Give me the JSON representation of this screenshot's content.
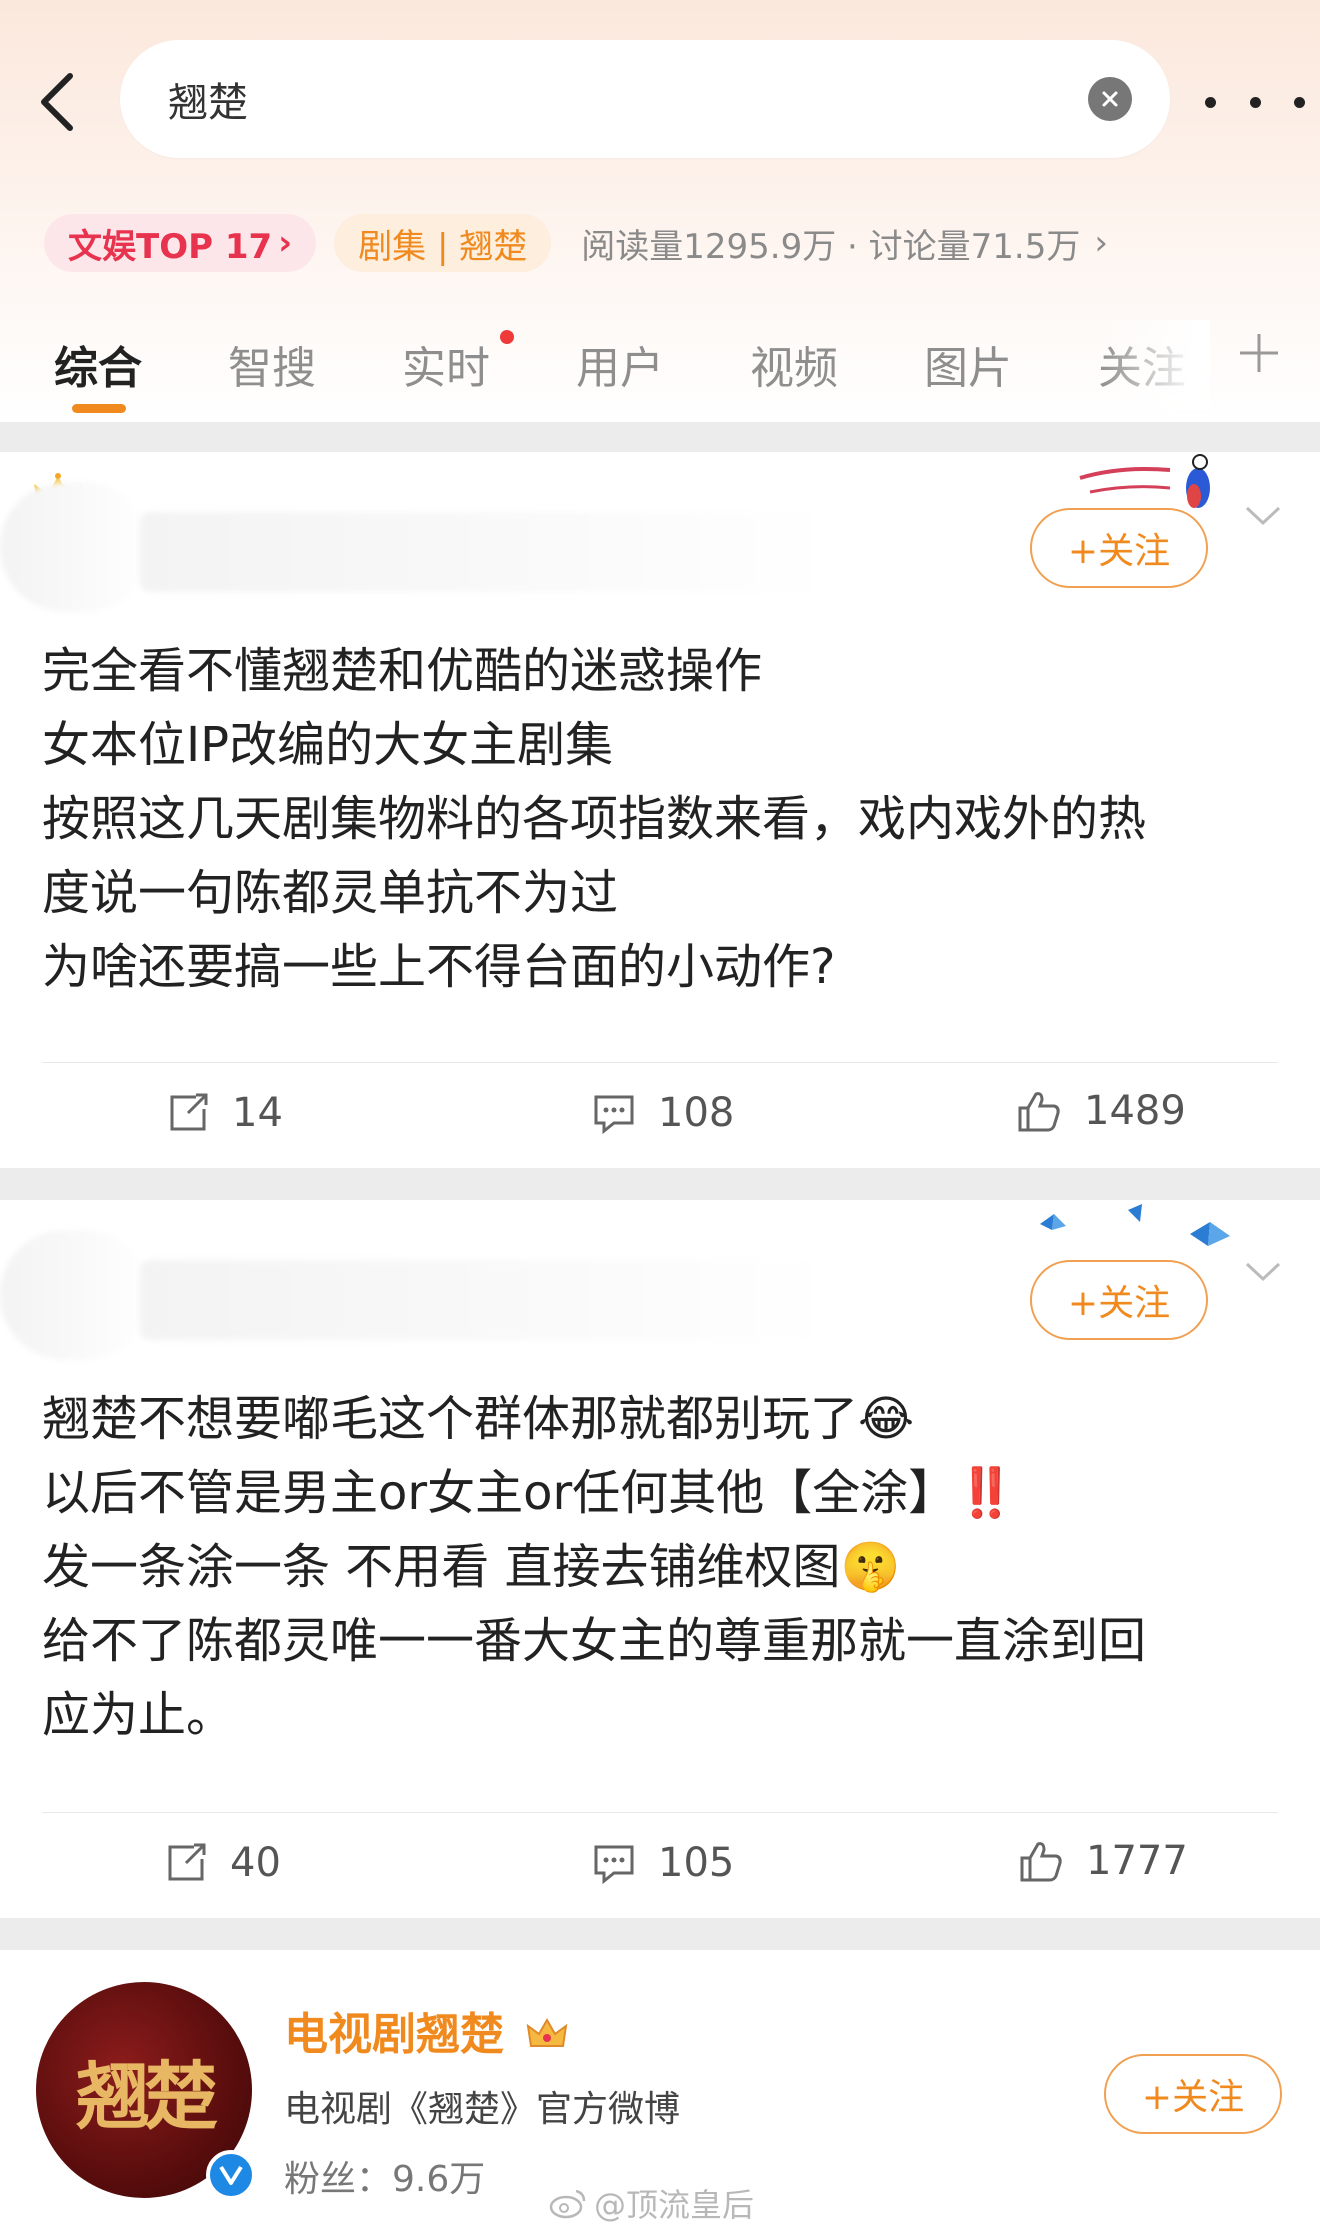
{
  "search": {
    "query": "翘楚"
  },
  "topic": {
    "rank_tag": "文娱TOP 17",
    "series_tag": "剧集 | 翘楚",
    "stats": "阅读量1295.9万 · 讨论量71.5万"
  },
  "tabs": [
    "综合",
    "智搜",
    "实时",
    "用户",
    "视频",
    "图片",
    "关注"
  ],
  "active_tab": "综合",
  "follow_label": "+关注",
  "posts": [
    {
      "lines": [
        "完全看不懂翘楚和优酷的迷惑操作",
        "女本位IP改编的大女主剧集",
        "按照这几天剧集物料的各项指数来看，戏内戏外的热",
        "度说一句陈都灵单抗不为过",
        "为啥还要搞一些上不得台面的小动作?"
      ],
      "reposts": "14",
      "comments": "108",
      "likes": "1489"
    },
    {
      "lines": [
        "翘楚不想要嘟毛这个群体那就都别玩了😂",
        "以后不管是男主or女主or任何其他【全涂】‼️",
        "发一条涂一条 不用看 直接去铺维权图🤫",
        "给不了陈都灵唯一一番大女主的尊重那就一直涂到回",
        "应为止。"
      ],
      "reposts": "40",
      "comments": "105",
      "likes": "1777"
    }
  ],
  "account": {
    "name": "电视剧翘楚",
    "avatar_text": "翘楚",
    "description": "电视剧《翘楚》官方微博",
    "fans": "粉丝：9.6万",
    "follow_label": "+关注"
  },
  "watermark": "@顶流皇后",
  "colors": {
    "accent": "#f08a1e",
    "rank_red": "#e8334f",
    "verified_blue": "#1e88e5"
  }
}
